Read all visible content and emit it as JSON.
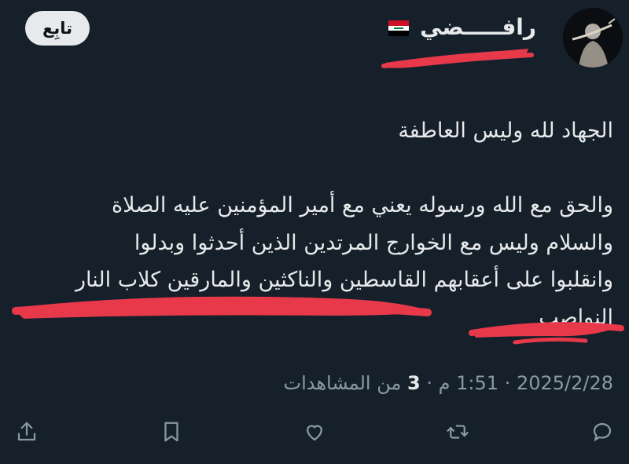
{
  "author": {
    "display_name": "رافـــــضي",
    "flag_icon": "iraq-flag-icon"
  },
  "follow_button": {
    "label": "تابِع"
  },
  "tweet": {
    "lines": [
      "الجهاد لله وليس العاطفة",
      "والحق مع الله ورسوله يعني مع أمير المؤمنين عليه الصلاة",
      "والسلام وليس مع الخوارج المرتدين الذين أحدثوا وبدلوا",
      "وانقلبوا على أعقابهم القاسطين والناكثين والمارقين كلاب النار",
      "النواصب"
    ]
  },
  "meta": {
    "date": "2025/2/28",
    "separator": "·",
    "time": "1:51 م",
    "views_count": "3",
    "views_label": "من المشاهدات"
  },
  "colors": {
    "background": "#15202b",
    "text": "#e7e9ea",
    "muted": "#8b98a5",
    "scribble": "#e8394a"
  },
  "actions": [
    "reply-icon",
    "retweet-icon",
    "like-icon",
    "bookmark-icon",
    "share-icon"
  ]
}
